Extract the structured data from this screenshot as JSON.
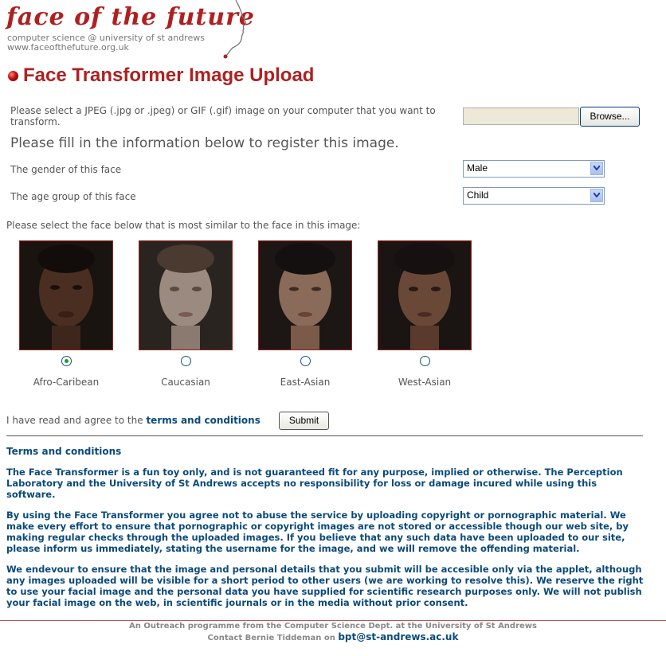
{
  "header": {
    "logo_title": "face of the future",
    "logo_subtitle": "computer science @ university of st andrews",
    "logo_url": "www.faceofthefuture.org.uk"
  },
  "page_title": "Face Transformer Image Upload",
  "upload": {
    "instruction": "Please select a JPEG (.jpg or .jpeg) or GIF (.gif) image on your computer that you want to transform.",
    "file_value": "",
    "browse_label": "Browse..."
  },
  "register_heading": "Please fill in the information below to register this image.",
  "gender": {
    "label": "The gender of this face",
    "selected": "Male"
  },
  "age": {
    "label": "The age group of this face",
    "selected": "Child"
  },
  "similar_prompt": "Please select the face below that is most similar to the face in this image:",
  "faces": [
    {
      "label": "Afro-Caribean",
      "checked": true,
      "skin": "#4a2e22"
    },
    {
      "label": "Caucasian",
      "checked": false,
      "skin": "#9a8a80"
    },
    {
      "label": "East-Asian",
      "checked": false,
      "skin": "#8a6a58"
    },
    {
      "label": "West-Asian",
      "checked": false,
      "skin": "#6a4838"
    }
  ],
  "agree": {
    "text": "I have read and agree to the ",
    "link": "terms and conditions",
    "submit_label": "Submit"
  },
  "terms": {
    "heading": "Terms and conditions",
    "p1": "The Face Transformer is a fun toy only, and is not guaranteed fit for any purpose, implied or otherwise. The Perception Laboratory and the University of St Andrews accepts no responsibility for loss or damage incured while using this software.",
    "p2": "By using the Face Transformer you agree not to abuse the service by uploading copyright or pornographic material. We make every effort to ensure that pornographic or copyright images are not stored or accessible though our web site, by making regular checks through the uploaded images. If you believe that any such data have been uploaded to our site, please inform us immediately, stating the username for the image, and we will remove the offending material.",
    "p3": "We endevour to ensure that the image and personal details that you submit will be accesible only via the applet, although any images uploaded will be visible for a short period to other users (we are working to resolve this). We reserve the right to use your facial image and the personal data you have supplied for scientific research purposes only. We will not publish your facial image on the web, in scientific journals or in the media without prior consent."
  },
  "footer": {
    "line1": "An Outreach programme from the Computer Science Dept. at the University of St Andrews",
    "contact_prefix": "Contact Bernie Tiddeman on ",
    "email": "bpt@st-andrews.ac.uk"
  }
}
